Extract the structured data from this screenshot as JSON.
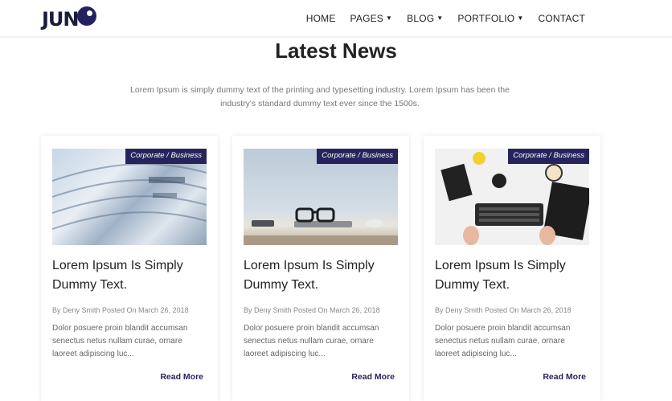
{
  "header": {
    "logo_text": "JUN",
    "nav": [
      {
        "label": "HOME",
        "has_dropdown": false
      },
      {
        "label": "PAGES",
        "has_dropdown": true
      },
      {
        "label": "BLOG",
        "has_dropdown": true
      },
      {
        "label": "PORTFOLIO",
        "has_dropdown": true
      },
      {
        "label": "CONTACT",
        "has_dropdown": false
      }
    ]
  },
  "section": {
    "title": "Latest News",
    "intro": "Lorem Ipsum is simply dummy text of the printing and typesetting industry. Lorem Ipsum has been the industry's standard dummy text ever since the 1500s."
  },
  "cards": [
    {
      "tag": "Corporate  /  Business",
      "image": "newspapers",
      "title": "Lorem Ipsum Is Simply Dummy Text.",
      "meta": "By Deny Smith Posted On March 26, 2018",
      "excerpt": "Dolor posuere proin blandit accumsan senectus netus nullam curae, ornare laoreet adipiscing luc...",
      "read_more": "Read More"
    },
    {
      "tag": "Corporate  /  Business",
      "image": "glasses-laptop",
      "title": "Lorem Ipsum Is Simply Dummy Text.",
      "meta": "By Deny Smith Posted On March 26, 2018",
      "excerpt": "Dolor posuere proin blandit accumsan senectus netus nullam curae, ornare laoreet adipiscing luc...",
      "read_more": "Read More"
    },
    {
      "tag": "Corporate  /  Business",
      "image": "desk-keyboard",
      "title": "Lorem Ipsum Is Simply Dummy Text.",
      "meta": "By Deny Smith Posted On March 26, 2018",
      "excerpt": "Dolor posuere proin blandit accumsan senectus netus nullam curae, ornare laoreet adipiscing luc...",
      "read_more": "Read More"
    }
  ],
  "colors": {
    "accent": "#27235c",
    "text": "#222222",
    "muted": "#777777"
  }
}
